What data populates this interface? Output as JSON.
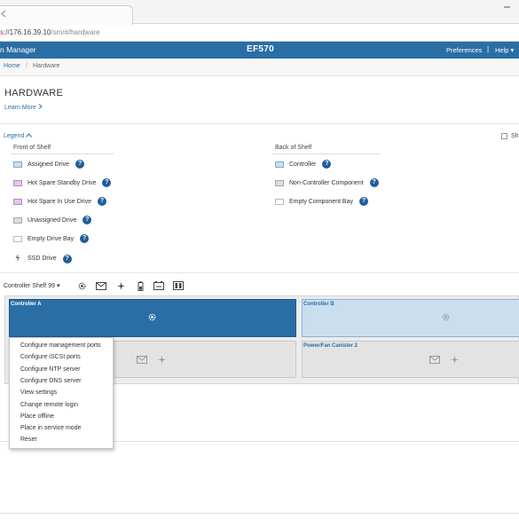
{
  "browser": {
    "url_proto": "s",
    "url_host": "://176.16.39.10",
    "url_path": "/sm/#/hardware",
    "icons": [
      "back-icon",
      "minimize-icon"
    ]
  },
  "header": {
    "app_name": "n Manager",
    "system_name": "EF570",
    "preferences": "Preferences",
    "separator": "|",
    "help": "Help",
    "help_caret": "▾"
  },
  "breadcrumb": {
    "home": "Home",
    "separator": "/",
    "current": "Hardware"
  },
  "page": {
    "title": "HARDWARE",
    "learn_more": "Learn More"
  },
  "legend": {
    "toggle": "Legend",
    "show_label": "Sh",
    "front_title": "Front of Shelf",
    "back_title": "Back of Shelf",
    "front_items": [
      {
        "label": "Assigned Drive",
        "color": "#c9dff0",
        "border": "#7ea9cf"
      },
      {
        "label": "Hot Spare Standby Drive",
        "color": "#e2c6ea",
        "border": "#b58bc2"
      },
      {
        "label": "Hot Spare In Use Drive",
        "color": "#e2c6ea",
        "border": "#b58bc2"
      },
      {
        "label": "Unassigned Drive",
        "color": "#dcdcdc",
        "border": "#aaaaaa"
      },
      {
        "label": "Empty Drive Bay",
        "color": "#ffffff",
        "border": "#bbbbbb"
      },
      {
        "label": "SSD Drive",
        "icon": "bolt-icon"
      }
    ],
    "back_items": [
      {
        "label": "Controller",
        "color": "#c9dff0",
        "border": "#7ea9cf"
      },
      {
        "label": "Non-Controller Component",
        "color": "#dcdcdc",
        "border": "#aaaaaa"
      },
      {
        "label": "Empty Component Bay",
        "color": "#ffffff",
        "border": "#bbbbbb"
      }
    ],
    "help_glyph": "?"
  },
  "shelf_toolbar": {
    "shelf_name": "Controller Shelf 99",
    "caret": "▾",
    "icons": [
      "gear-chip-icon",
      "envelope-icon",
      "fan-icon",
      "battery-icon",
      "temperature-icon",
      "power-supply-icon"
    ]
  },
  "shelf": {
    "controller_a": "Controller A",
    "controller_b": "Controller B",
    "power_fan_2": "Power/Fan Canister 2"
  },
  "context_menu": {
    "items": [
      "Configure management ports",
      "Configure iSCSI ports",
      "Configure NTP server",
      "Configure DNS server",
      "View settings",
      "Change remote login",
      "Place offline",
      "Place in service mode",
      "Reset"
    ]
  },
  "colors": {
    "brand": "#2a6ea6",
    "help_icon": "#1f5f99"
  }
}
